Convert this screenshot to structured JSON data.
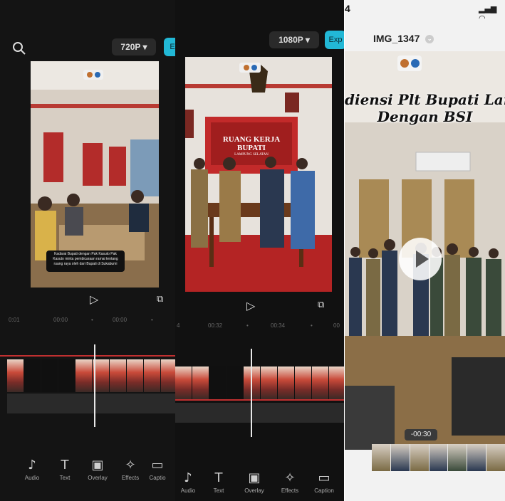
{
  "left_editor": {
    "resolution_label": "720P ▾",
    "export_partial": "E",
    "ruler_ticks": [
      "0:01",
      "00:00",
      "•",
      "00:00",
      "•"
    ],
    "caption_text": "Kadarai Bupati dengan Pak Kasuto Pak Kasuto minta pembicaraan ramai tentang ruang raya oleh dari Bupati di Sukabumi",
    "tools": [
      {
        "icon": "music-note-icon",
        "glyph": "♪",
        "label": "Audio"
      },
      {
        "icon": "text-icon",
        "glyph": "T",
        "label": "Text"
      },
      {
        "icon": "overlay-icon",
        "glyph": "▣",
        "label": "Overlay"
      },
      {
        "icon": "effects-icon",
        "glyph": "✧",
        "label": "Effects"
      },
      {
        "icon": "captions-icon",
        "glyph": "▭",
        "label": "Captio"
      }
    ]
  },
  "middle_editor": {
    "resolution_label": "1080P ▾",
    "export_partial": "Exp",
    "room_sign_lines": [
      "RUANG KERJA",
      "BUPATI",
      "LAMPUNG SELATAN"
    ],
    "ruler_ticks": [
      "4",
      "00:32",
      "•",
      "00:34",
      "•",
      "00"
    ],
    "tools": [
      {
        "icon": "music-note-icon",
        "glyph": "♪",
        "label": "Audio"
      },
      {
        "icon": "text-icon",
        "glyph": "T",
        "label": "Text"
      },
      {
        "icon": "overlay-icon",
        "glyph": "▣",
        "label": "Overlay"
      },
      {
        "icon": "effects-icon",
        "glyph": "✧",
        "label": "Effects"
      },
      {
        "icon": "captions-icon",
        "glyph": "▭",
        "label": "Caption"
      }
    ]
  },
  "photos_viewer": {
    "status_time": "4",
    "status_icons": "signal-wifi",
    "file_name": "IMG_1347",
    "title_line1": "diensi Plt Bupati Lam",
    "title_line2": "Dengan BSI",
    "timestamp": "-00:30"
  },
  "colors": {
    "editor_bg": "#141414",
    "export_accent": "#22b8d6",
    "track_red": "#c03030"
  }
}
